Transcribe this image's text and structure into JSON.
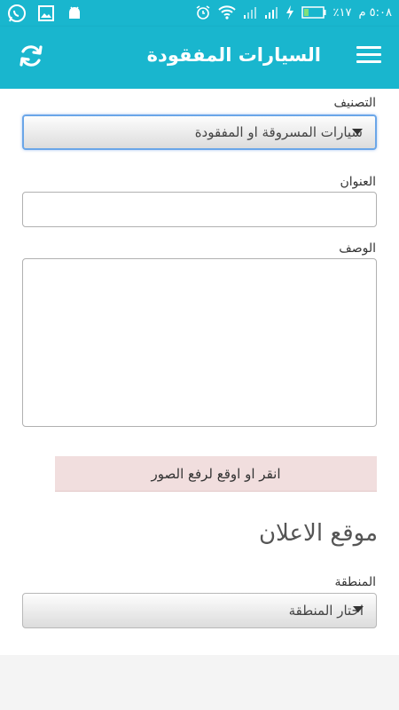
{
  "status_bar": {
    "time": "٥:٠٨ م",
    "battery": "٪١٧",
    "icons": [
      "whatsapp-icon",
      "image-icon",
      "android-icon",
      "alarm-icon",
      "wifi-icon",
      "signal-icon",
      "signal-icon",
      "charging-icon",
      "battery-icon"
    ]
  },
  "app_bar": {
    "title": "السيارات المفقودة",
    "left_icon": "refresh-icon",
    "right_icon": "menu-icon",
    "accent_color": "#19b6ce"
  },
  "form": {
    "category": {
      "label": "التصنيف",
      "selected": "سيارات المسروقة او المفقودة"
    },
    "title_field": {
      "label": "العنوان",
      "value": ""
    },
    "description_field": {
      "label": "الوصف",
      "value": ""
    },
    "upload_button": "انقر او اوقع لرفع الصور",
    "location_section_title": "موقع الاعلان",
    "region": {
      "label": "المنطقة",
      "selected": "احتار المنطقة"
    }
  }
}
